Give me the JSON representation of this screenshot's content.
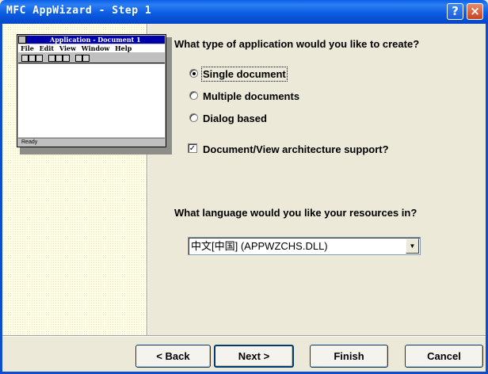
{
  "window": {
    "title": "MFC AppWizard - Step 1",
    "help_glyph": "?",
    "close_glyph": "×"
  },
  "preview": {
    "title": "Application - Document 1",
    "menu": [
      "File",
      "Edit",
      "View",
      "Window",
      "Help"
    ],
    "status": "Ready"
  },
  "app_type": {
    "question": "What type of application would you like to create?",
    "options": [
      {
        "label": "Single document",
        "selected": true
      },
      {
        "label": "Multiple documents",
        "selected": false
      },
      {
        "label": "Dialog based",
        "selected": false
      }
    ],
    "docview": {
      "label": "Document/View architecture support?",
      "checked": true,
      "check_glyph": "✓"
    }
  },
  "language": {
    "question": "What language would you like your resources in?",
    "selected": "中文[中国] (APPWZCHS.DLL)",
    "arrow_glyph": "▼"
  },
  "buttons": {
    "back": "< Back",
    "next": "Next >",
    "finish": "Finish",
    "cancel": "Cancel"
  }
}
